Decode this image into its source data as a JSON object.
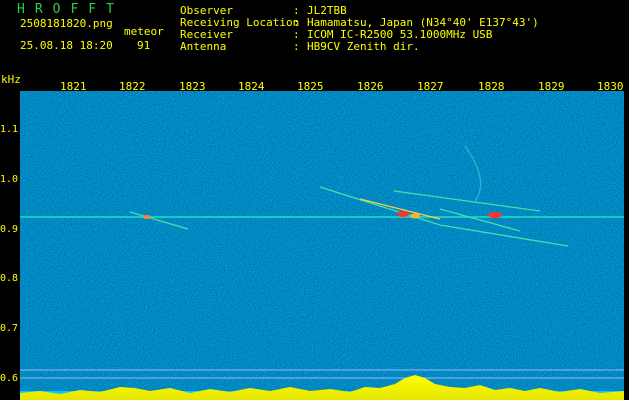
{
  "header": {
    "logo": "HROFFT",
    "filename": "2508181820.png",
    "datetime": "25.08.18 18:20",
    "mode_label": "meteor",
    "count": "91",
    "labels": [
      "Observer",
      "Receiving Location",
      "Receiver",
      "Antenna"
    ],
    "sep": ":",
    "values": [
      "JL2TBB",
      "Hamamatsu, Japan (N34°40' E137°43')",
      "ICOM IC-R2500 53.1000MHz USB",
      "HB9CV Zenith dir."
    ]
  },
  "axes": {
    "y_unit": "kHz",
    "y_ticks": [
      "1.1",
      "1.0",
      "0.9",
      "0.8",
      "0.7",
      "0.6"
    ],
    "x_ticks": [
      "1821",
      "1822",
      "1823",
      "1824",
      "1825",
      "1826",
      "1827",
      "1828",
      "1829",
      "1830"
    ]
  },
  "colors": {
    "background": "#000000",
    "text": "#ffff00",
    "logo": "#2ecc40",
    "spectrogram_bg": "#08146e"
  }
}
